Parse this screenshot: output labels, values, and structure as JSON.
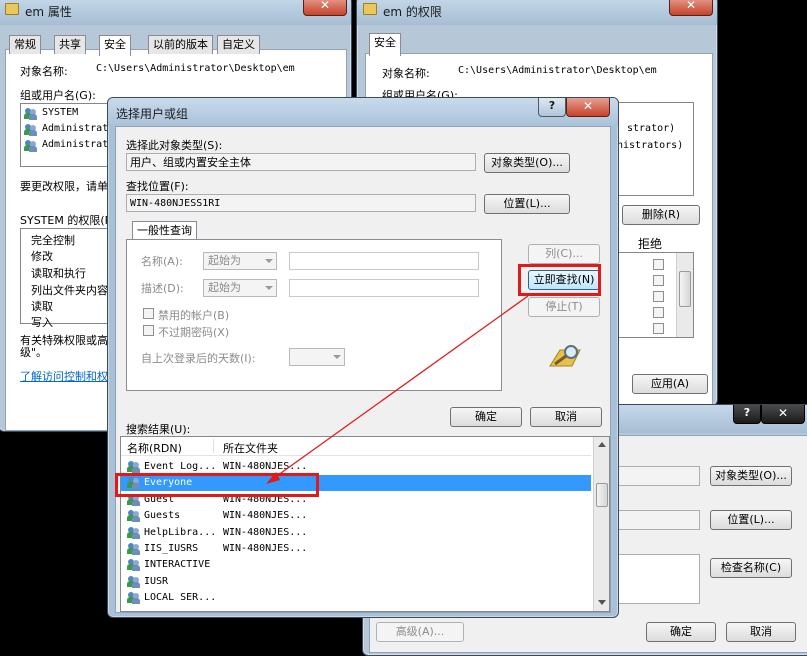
{
  "win1": {
    "title": "em 属性",
    "close": "✕",
    "tabs": [
      "常规",
      "共享",
      "安全",
      "以前的版本",
      "自定义"
    ],
    "object_label": "对象名称:",
    "object_value": "C:\\Users\\Administrator\\Desktop\\em",
    "groups_label": "组或用户名(G):",
    "users": [
      "SYSTEM",
      "Administrat",
      "Administrat"
    ],
    "change_text": "要更改权限，请单",
    "perm_label": "SYSTEM 的权限(P",
    "perms": [
      "完全控制",
      "修改",
      "读取和执行",
      "列出文件夹内容",
      "读取",
      "写入"
    ],
    "special_text_1": "有关特殊权限或高",
    "special_text_2": "级\"。",
    "link": "了解访问控制和权"
  },
  "win2": {
    "title": "em 的权限",
    "close": "✕",
    "tab": "安全",
    "object_label": "对象名称:",
    "object_value": "C:\\Users\\Administrator\\Desktop\\em",
    "groups_label": "组或用户名(G):",
    "list_right_1": "strator)",
    "list_right_2": "nistrators)",
    "remove_button": "删除(R)",
    "deny_header": "拒绝",
    "apply_button": "应用(A)"
  },
  "win3": {
    "help": "?",
    "close": "✕",
    "object_types_button": "对象类型(O)...",
    "locations_button": "位置(L)...",
    "check_names_button": "检查名称(C)",
    "advanced_button": "高级(A)...",
    "ok_button": "确定",
    "cancel_button": "取消"
  },
  "dialog": {
    "title": "选择用户或组",
    "help": "?",
    "close": "✕",
    "object_type_label": "选择此对象类型(S):",
    "object_type_value": "用户、组或内置安全主体",
    "object_types_button": "对象类型(O)...",
    "location_label": "查找位置(F):",
    "location_value": "WIN-480NJESS1RI",
    "locations_button": "位置(L)...",
    "common_tab": "一般性查询",
    "name_label": "名称(A):",
    "name_combo": "起始为",
    "desc_label": "描述(D):",
    "desc_combo": "起始为",
    "disabled_accounts": "禁用的帐户(B)",
    "non_expiring": "不过期密码(X)",
    "days_label": "自上次登录后的天数(I):",
    "columns_button": "列(C)...",
    "find_now_button": "立即查找(N)",
    "stop_button": "停止(T)",
    "ok_button": "确定",
    "cancel_button": "取消",
    "results_label": "搜索结果(U):",
    "col_name": "名称(RDN)",
    "col_folder": "所在文件夹",
    "rows": [
      {
        "name": "Event Log...",
        "folder": "WIN-480NJES..."
      },
      {
        "name": "Everyone",
        "folder": ""
      },
      {
        "name": "Guest",
        "folder": "WIN-480NJES..."
      },
      {
        "name": "Guests",
        "folder": "WIN-480NJES..."
      },
      {
        "name": "HelpLibra...",
        "folder": "WIN-480NJES..."
      },
      {
        "name": "IIS_IUSRS",
        "folder": "WIN-480NJES..."
      },
      {
        "name": "INTERACTIVE",
        "folder": ""
      },
      {
        "name": "IUSR",
        "folder": ""
      },
      {
        "name": "LOCAL SER...",
        "folder": ""
      }
    ]
  },
  "colors": {
    "highlight": "#3399ff",
    "annotation": "#e0191b"
  }
}
